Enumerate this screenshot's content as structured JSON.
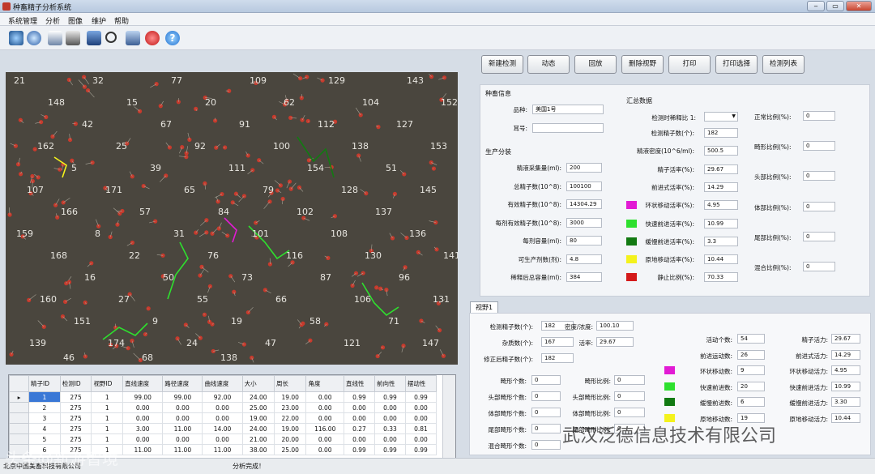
{
  "window": {
    "title": "种畜精子分析系统",
    "controls": [
      "‒",
      "▭",
      "✕"
    ]
  },
  "menu": [
    "系统管理",
    "分析",
    "图像",
    "维护",
    "帮助"
  ],
  "toolbar_icons": [
    "camera-icon",
    "disc-icon",
    "document-icon",
    "printer-icon",
    "book-icon",
    "search-icon",
    "tools-icon",
    "power-icon",
    "help-icon"
  ],
  "actions": [
    "新建检测",
    "动态",
    "回放",
    "删除视野",
    "打印",
    "打印选择",
    "检测列表"
  ],
  "animal": {
    "title": "种畜信息",
    "breed_label": "品种:",
    "breed_value": "美国1号",
    "ear_label": "耳号:",
    "ear_value": ""
  },
  "production": {
    "title": "生产分装",
    "rows": [
      {
        "label": "精液采集量(ml):",
        "value": "200"
      },
      {
        "label": "总精子数(10^8):",
        "value": "100100"
      },
      {
        "label": "有效精子数(10^8):",
        "value": "14304.29"
      },
      {
        "label": "每剂有效精子数(10^8):",
        "value": "3000"
      },
      {
        "label": "每剂容量(ml):",
        "value": "80"
      },
      {
        "label": "可生产剂数(剂):",
        "value": "4.8"
      },
      {
        "label": "稀释后总容量(ml):",
        "value": "384"
      }
    ]
  },
  "summary": {
    "title": "汇总数据",
    "dilution_label": "检测时稀释比 1:",
    "dilution_value": "",
    "rows": [
      {
        "label": "检测精子数(个):",
        "value": "182",
        "color": ""
      },
      {
        "label": "精液密度(10^6/ml):",
        "value": "500.5",
        "color": ""
      },
      {
        "label": "精子活率(%):",
        "value": "29.67",
        "color": ""
      },
      {
        "label": "前进式活率(%):",
        "value": "14.29",
        "color": ""
      },
      {
        "label": "环状移动活率(%):",
        "value": "4.95",
        "color": "#e21bd4"
      },
      {
        "label": "快速前进活率(%):",
        "value": "10.99",
        "color": "#2ee02e"
      },
      {
        "label": "缓慢前进活率(%):",
        "value": "3.3",
        "color": "#127a12"
      },
      {
        "label": "原地移动活率(%):",
        "value": "10.44",
        "color": "#f4f21c"
      },
      {
        "label": "静止比例(%):",
        "value": "70.33",
        "color": "#d41a1a"
      }
    ],
    "morph": [
      {
        "label": "正常比例(%):",
        "value": "0"
      },
      {
        "label": "畸形比例(%):",
        "value": "0"
      },
      {
        "label": "头部比例(%):",
        "value": "0"
      },
      {
        "label": "体部比例(%):",
        "value": "0"
      },
      {
        "label": "尾部比例(%):",
        "value": "0"
      },
      {
        "label": "混合比例(%):",
        "value": "0"
      }
    ]
  },
  "view": {
    "tab": "视野1",
    "left": [
      {
        "label": "检测精子数(个):",
        "value": "182"
      },
      {
        "label": "杂质数(个):",
        "value": "167"
      },
      {
        "label": "修正后精子数(个):",
        "value": "182"
      }
    ],
    "density_label": "密度/浓度:",
    "density_value": "100.10",
    "motility_label": "活率:",
    "motility_value": "29.67",
    "abn_left": [
      {
        "label": "畸形个数:",
        "value": "0"
      },
      {
        "label": "头部畸形个数:",
        "value": "0"
      },
      {
        "label": "体部畸形个数:",
        "value": "0"
      },
      {
        "label": "尾部畸形个数:",
        "value": "0"
      },
      {
        "label": "混合畸形个数:",
        "value": "0"
      }
    ],
    "abn_right": [
      {
        "label": "畸形比例:",
        "value": "0"
      },
      {
        "label": "头部畸形比例:",
        "value": "0"
      },
      {
        "label": "体部畸形比例:",
        "value": "0"
      },
      {
        "label": "尾部畸形比例:",
        "value": "0"
      }
    ],
    "counts": [
      {
        "label": "活动个数:",
        "value": "54",
        "color": ""
      },
      {
        "label": "前进运动数:",
        "value": "26",
        "color": ""
      },
      {
        "label": "环状移动数:",
        "value": "9",
        "color": "#e21bd4"
      },
      {
        "label": "快速前进数:",
        "value": "20",
        "color": "#2ee02e"
      },
      {
        "label": "缓慢前进数:",
        "value": "6",
        "color": "#127a12"
      },
      {
        "label": "原地移动数:",
        "value": "19",
        "color": "#f4f21c"
      }
    ],
    "rates": [
      {
        "label": "精子活力:",
        "value": "29.67"
      },
      {
        "label": "前进式活力:",
        "value": "14.29"
      },
      {
        "label": "环状移动活力:",
        "value": "4.95"
      },
      {
        "label": "快速前进活力:",
        "value": "10.99"
      },
      {
        "label": "缓慢前进活力:",
        "value": "3.30"
      },
      {
        "label": "原地移动活力:",
        "value": "10.44"
      }
    ]
  },
  "table": {
    "headers": [
      "精子ID",
      "检测ID",
      "视野ID",
      "直线速度",
      "路径速度",
      "曲线速度",
      "大小",
      "周长",
      "角度",
      "直线性",
      "前向性",
      "摆动性"
    ],
    "rows": [
      [
        "1",
        "275",
        "1",
        "99.00",
        "99.00",
        "92.00",
        "24.00",
        "19.00",
        "0.00",
        "0.99",
        "0.99",
        "0.99"
      ],
      [
        "2",
        "275",
        "1",
        "0.00",
        "0.00",
        "0.00",
        "25.00",
        "23.00",
        "0.00",
        "0.00",
        "0.00",
        "0.00"
      ],
      [
        "3",
        "275",
        "1",
        "0.00",
        "0.00",
        "0.00",
        "19.00",
        "22.00",
        "0.00",
        "0.00",
        "0.00",
        "0.00"
      ],
      [
        "4",
        "275",
        "1",
        "3.00",
        "11.00",
        "14.00",
        "24.00",
        "19.00",
        "116.00",
        "0.27",
        "0.33",
        "0.81"
      ],
      [
        "5",
        "275",
        "1",
        "0.00",
        "0.00",
        "0.00",
        "21.00",
        "20.00",
        "0.00",
        "0.00",
        "0.00",
        "0.00"
      ],
      [
        "6",
        "275",
        "1",
        "11.00",
        "11.00",
        "11.00",
        "38.00",
        "25.00",
        "0.00",
        "0.99",
        "0.99",
        "0.99"
      ]
    ]
  },
  "status": {
    "left": "北京中国美畜科技有限公司",
    "center": "分析完成！"
  },
  "watermark": {
    "left": "头条@新游智境",
    "right": "武汉泛德信息技术有限公司"
  },
  "cell_labels": [
    "21",
    "32",
    "77",
    "109",
    "129",
    "143",
    "148",
    "15",
    "20",
    "62",
    "104",
    "152",
    "42",
    "67",
    "91",
    "112",
    "127",
    "162",
    "25",
    "92",
    "100",
    "138",
    "153",
    "5",
    "39",
    "111",
    "154",
    "51",
    "107",
    "171",
    "65",
    "79",
    "128",
    "145",
    "166",
    "57",
    "84",
    "102",
    "137",
    "159",
    "8",
    "31",
    "101",
    "108",
    "136",
    "168",
    "22",
    "76",
    "116",
    "130",
    "141",
    "16",
    "50",
    "73",
    "87",
    "96",
    "160",
    "27",
    "55",
    "66",
    "106",
    "131",
    "151",
    "9",
    "19",
    "58",
    "71",
    "139",
    "174",
    "24",
    "47",
    "121",
    "147",
    "46",
    "68",
    "138"
  ]
}
